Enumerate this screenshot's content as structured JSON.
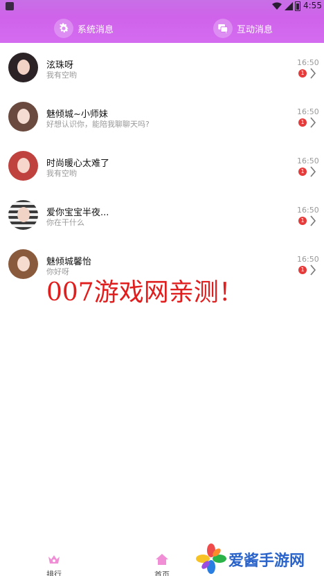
{
  "status_bar": {
    "time": "4:55"
  },
  "tabs": [
    {
      "label": "系统消息",
      "icon": "gear-icon"
    },
    {
      "label": "互动消息",
      "icon": "chat-icon"
    }
  ],
  "messages": [
    {
      "name": "泫珠呀",
      "preview": "我有空哟",
      "time": "16:50",
      "unread": "1"
    },
    {
      "name": "魅倾城~小师妹",
      "preview": "好想认识你，能陪我聊聊天吗?",
      "time": "16:50",
      "unread": "1"
    },
    {
      "name": "时尚暖心太难了",
      "preview": "我有空哟",
      "time": "16:50",
      "unread": "1"
    },
    {
      "name": "爱你宝宝半夜...",
      "preview": "你在干什么",
      "time": "16:50",
      "unread": "1"
    },
    {
      "name": "魅倾城馨怡",
      "preview": "你好呀",
      "time": "16:50",
      "unread": "1"
    }
  ],
  "watermark": "007游戏网亲测！",
  "bottom_nav": [
    {
      "label": "排行",
      "icon": "crown-icon"
    },
    {
      "label": "首页",
      "icon": "home-icon"
    }
  ],
  "corner_logo": {
    "text": "爱酱手游网"
  },
  "colors": {
    "header": "#d46cf0",
    "badge": "#e53b3b",
    "watermark": "#e01e1e",
    "nav_icon": "#f08fd6",
    "logo_text": "#2a63c9"
  }
}
